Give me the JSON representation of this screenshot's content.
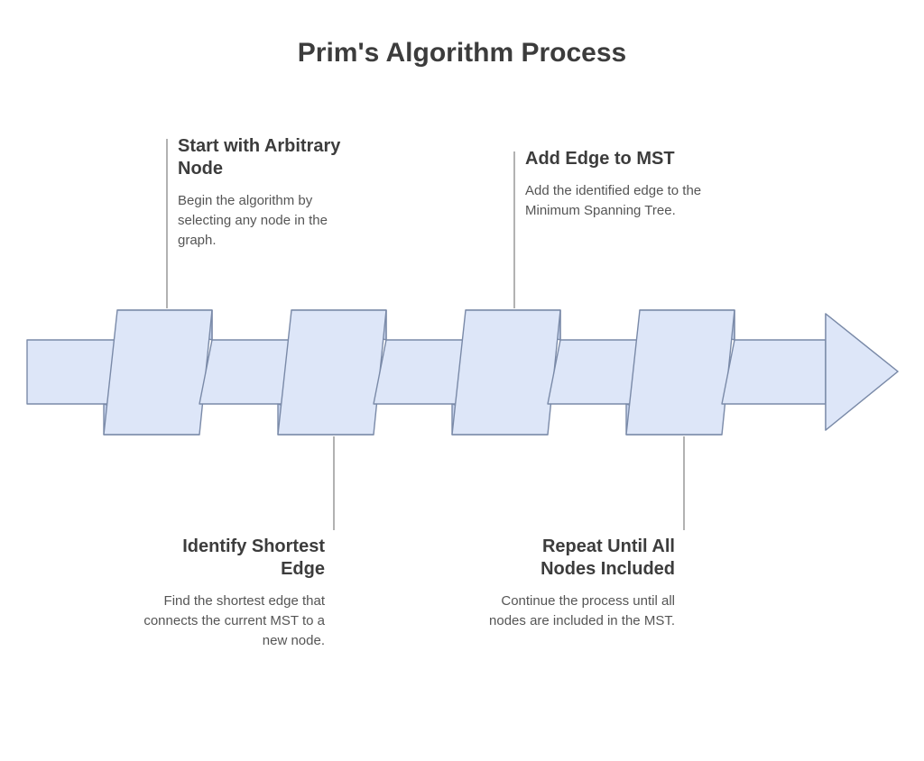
{
  "title": "Prim's Algorithm Process",
  "steps": [
    {
      "title": "Start with Arbitrary Node",
      "desc": "Begin the algorithm by selecting any node in the graph."
    },
    {
      "title": "Identify Shortest Edge",
      "desc": "Find the shortest edge that connects the current MST to a new node."
    },
    {
      "title": "Add Edge to MST",
      "desc": "Add the identified edge to the Minimum Spanning Tree."
    },
    {
      "title": "Repeat Until All Nodes Included",
      "desc": "Continue the process until all nodes are included in the MST."
    }
  ],
  "colors": {
    "ribbonFill": "#dde6f8",
    "ribbonStroke": "#7a8aa8",
    "shadowFill": "#c7d4ee"
  }
}
